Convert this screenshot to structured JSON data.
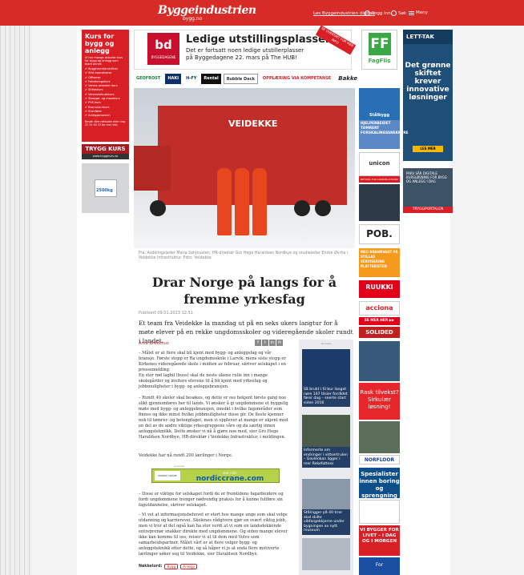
{
  "header": {
    "logo": "Byggeindustrien",
    "logo_sub": "bygg.no",
    "top_link": "Les Byggeindustrien digitalt",
    "login": "Logg inn",
    "search": "Søk",
    "menu": "Meny"
  },
  "ads": {
    "left_course": {
      "title": "Kurs for bygg og anlegg",
      "sub": "Vi har mange aktuelle kurs for bygg og anlegg som blant annet:",
      "items": [
        "Byggherreforskriften",
        "SHA-koordinator",
        "Offiserer",
        "Fallsikringskurs",
        "Varme arbeider kurs",
        "Stillaskurs",
        "Verneombudskurs",
        "Stroppe- og masekurs",
        "PSE-kurs",
        "Brannvernkurs",
        "Kranfører",
        "Anleggsmaskin"
      ],
      "foot": "Besøk våre nettsider eller ring 22 34 40 23 for mer info."
    },
    "trygg": "TRYGG KURS",
    "trygg_url": "www.tryggkurs.no",
    "bag": "2500kg",
    "top_banner": {
      "logo": "bd",
      "logo_name": "BYGGEDAGENE",
      "title": "Ledige utstillingsplasser",
      "text": "Det er fortsatt noen ledige utstillerplasser på Byggedagene 22. mars på The HUB!",
      "ribbon": "SE OVERSIKT FOR MER INFO"
    },
    "ff": {
      "mark": "FF",
      "name": "FagFlis"
    },
    "lett": {
      "brand": "LETT-TAK",
      "message": "Det grønne skiftet krever innovative løsninger",
      "more": "LES MER"
    },
    "panel": "PARV SÅR DIGITALE KURSLØSNING FOR BYGG OG ANLEGG I DAG",
    "tryggportalen": "TRYGGPORTALEN",
    "logos": [
      "GEOFROST",
      "HAKI",
      "H-FY",
      "Rental",
      "Bubble Deck",
      "OPPLÆRING VIA KOMPETANSE",
      "Bakke"
    ],
    "right": {
      "stalbygg": "Stålbygg",
      "hjelp": "HJELPERBEIDET TØMRERT FORSKALINGSSNEKKERE",
      "unicon": "unicon",
      "unicon_bar": "BETONG FOR CONSTRUCTIONS",
      "pob": "POB.",
      "orange": "MED BRANNVAGT PÅ STILLAS SERVISERING PLATTERISTEN",
      "ruukki": "RUUKKI",
      "acciona": "acciona",
      "se_mer": "SE MER HER ▶▶",
      "solid": "SOLIDED",
      "rask": "Rask tilvekst? Sirkulær løsning!",
      "norfloor": "NORFLOOR",
      "spes": "Spesialister innen boring og sprengning",
      "vi": "VI BYGGER FOR LIVET – I DAG OG I MORGEN",
      "for": "For"
    },
    "nordic": {
      "logo": "NORDIC CRANE",
      "more": "mer info:",
      "site": "nordiccrane.com"
    },
    "advertise_label": "annonse"
  },
  "article": {
    "caption": "Fra: Avdelingsleder Maria Sehjousten, HR-direktør Gro Hege Haraldsen Nordbye og studieleder Endre Øvrhe i Veidekke Infrastruktur. Foto: Veidekke",
    "truck_text": "VEIDEKKE",
    "title": "Drar Norge på langs for å fremme yrkesfag",
    "published": "Publisert 09.01.2023 12:51",
    "lead": "Et team fra Veidekke la mandag ut på en seks ukers langtur for å møte elever på en rekke ungdomsskoler og videregående skoler rundt i landet.",
    "author": "Arve Brekkhus",
    "share": [
      "f",
      "t",
      "in",
      "✉"
    ],
    "paragraphs": [
      "– Målet er at flere skal bli kjent med bygg- og anleggsfag og vår bransje. Første stopp er Ra ungdomsskole i Larvik, mens siste stopp er Kirkenes videregående skole i midten av februar, skriver selskapet i en pressemelding.",
      "En stor rød lagbil (buss) skal de neste ukene rulle inn i mange skolegårder og invitere elevene til å bli kjent med yrkesfag og jobbmuligheter i bygg- og anleggsbransjen.",
      "– Rundt 40 skoler skal besøkes, og dette er oss bekjent første gang noe slikt gjennomføres her til lands. Vi ønsker å gi ungdommene et byggelig møte med bygg- og anleggsbransjen, innsikt i hvilke fagområder som finnes og ikke minst hvilke jobbmuligheter disse gir. De fleste kjenner nok til tømrer- og betongfaget, men vi opplever at mange er ukjent med en del av de andre viktige yrkesgruppene våre og da særlig innen anleggstekniikk. Dette ønsker vi nå å gjøre noe med, sier Gro Hege Haraldsen Nordbye, HR-direktør i Veidekke Infrastruktur, i meldingen.",
      "Veidekke har nå rundt 200 lærlinger i Norge.",
      "– Disse er viktige for selskapet fordi de er fremtidens fagarbeidere og fordi ungdommene trenger nødvendig praksis for å kunne fullføre sin fagutdannelse, skriver selskapet.",
      "– Vi vet at informasjonsbehovet er stort hos mange unge som skal velge utdanning og karrierevei. Skolenes rådgivere gjør en svært viktig jobb, men vi tror at det også kan ha stor verdi at vi som en landsdekkende entreprenør snakker direkte med ungdommene. Og siden mange elever ikke kan komme til oss, reiser vi ut til dem med Volvo som samarbeidspartner. Målet vårt er at flere velger bygg- og anleggsteknikk etter dette, og så håper vi jo at enda flere motiverte lærlinger søker seg til Veidekke, sier Haraldsen Nordbye."
    ],
    "tags_label": "Nøkkelord:",
    "tags": [
      "Bygg",
      "Anlegg"
    ]
  },
  "sidebar": {
    "label": "annonse",
    "stories": [
      "Så brukt i til bur langet nøre 167 tilsier forrådet fører dag – seerte start siden 2016",
      "Informerte om endringer i vittsertrulen – Gavlenkan ligger i mer Rekefattess",
      "Stålrigger på 40 trier skal skilte vibfargekkjerne under bygningen av nytt museum"
    ]
  }
}
